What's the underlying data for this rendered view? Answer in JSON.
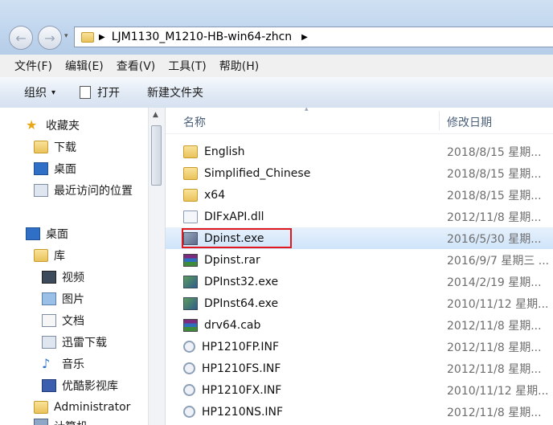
{
  "address": {
    "path": "LJM1130_M1210-HB-win64-zhcn"
  },
  "menu": [
    "文件(F)",
    "编辑(E)",
    "查看(V)",
    "工具(T)",
    "帮助(H)"
  ],
  "toolbar": {
    "organize": "组织",
    "open": "打开",
    "new_folder": "新建文件夹"
  },
  "nav": {
    "favorites": "收藏夹",
    "downloads": "下载",
    "desktop_fav": "桌面",
    "recent": "最近访问的位置",
    "desktop": "桌面",
    "libraries": "库",
    "videos": "视频",
    "pictures": "图片",
    "documents": "文档",
    "xunlei": "迅雷下载",
    "music": "音乐",
    "youku": "优酷影视库",
    "admin": "Administrator",
    "computer": "计算机"
  },
  "columns": {
    "name": "名称",
    "date": "修改日期"
  },
  "files": [
    {
      "name": "English",
      "date": "2018/8/15 星期...",
      "icon": "folder-icon"
    },
    {
      "name": "Simplified_Chinese",
      "date": "2018/8/15 星期...",
      "icon": "folder-icon"
    },
    {
      "name": "x64",
      "date": "2018/8/15 星期...",
      "icon": "folder-icon"
    },
    {
      "name": "DIFxAPI.dll",
      "date": "2012/11/8 星期...",
      "icon": "dll-file-icon"
    },
    {
      "name": "Dpinst.exe",
      "date": "2016/5/30 星期...",
      "icon": "exe-file-icon"
    },
    {
      "name": "Dpinst.rar",
      "date": "2016/9/7 星期三 ...",
      "icon": "rar-file-icon"
    },
    {
      "name": "DPInst32.exe",
      "date": "2014/2/19 星期...",
      "icon": "exe-file-icon"
    },
    {
      "name": "DPInst64.exe",
      "date": "2010/11/12 星期...",
      "icon": "exe-file-icon"
    },
    {
      "name": "drv64.cab",
      "date": "2012/11/8 星期...",
      "icon": "cab-file-icon"
    },
    {
      "name": "HP1210FP.INF",
      "date": "2012/11/8 星期...",
      "icon": "inf-file-icon"
    },
    {
      "name": "HP1210FS.INF",
      "date": "2012/11/8 星期...",
      "icon": "inf-file-icon"
    },
    {
      "name": "HP1210FX.INF",
      "date": "2010/11/12 星期...",
      "icon": "inf-file-icon"
    },
    {
      "name": "HP1210NS.INF",
      "date": "2012/11/8 星期...",
      "icon": "inf-file-icon"
    }
  ],
  "colors": {
    "highlight_box": "#e0181e",
    "selection": "#cfe4fa"
  }
}
